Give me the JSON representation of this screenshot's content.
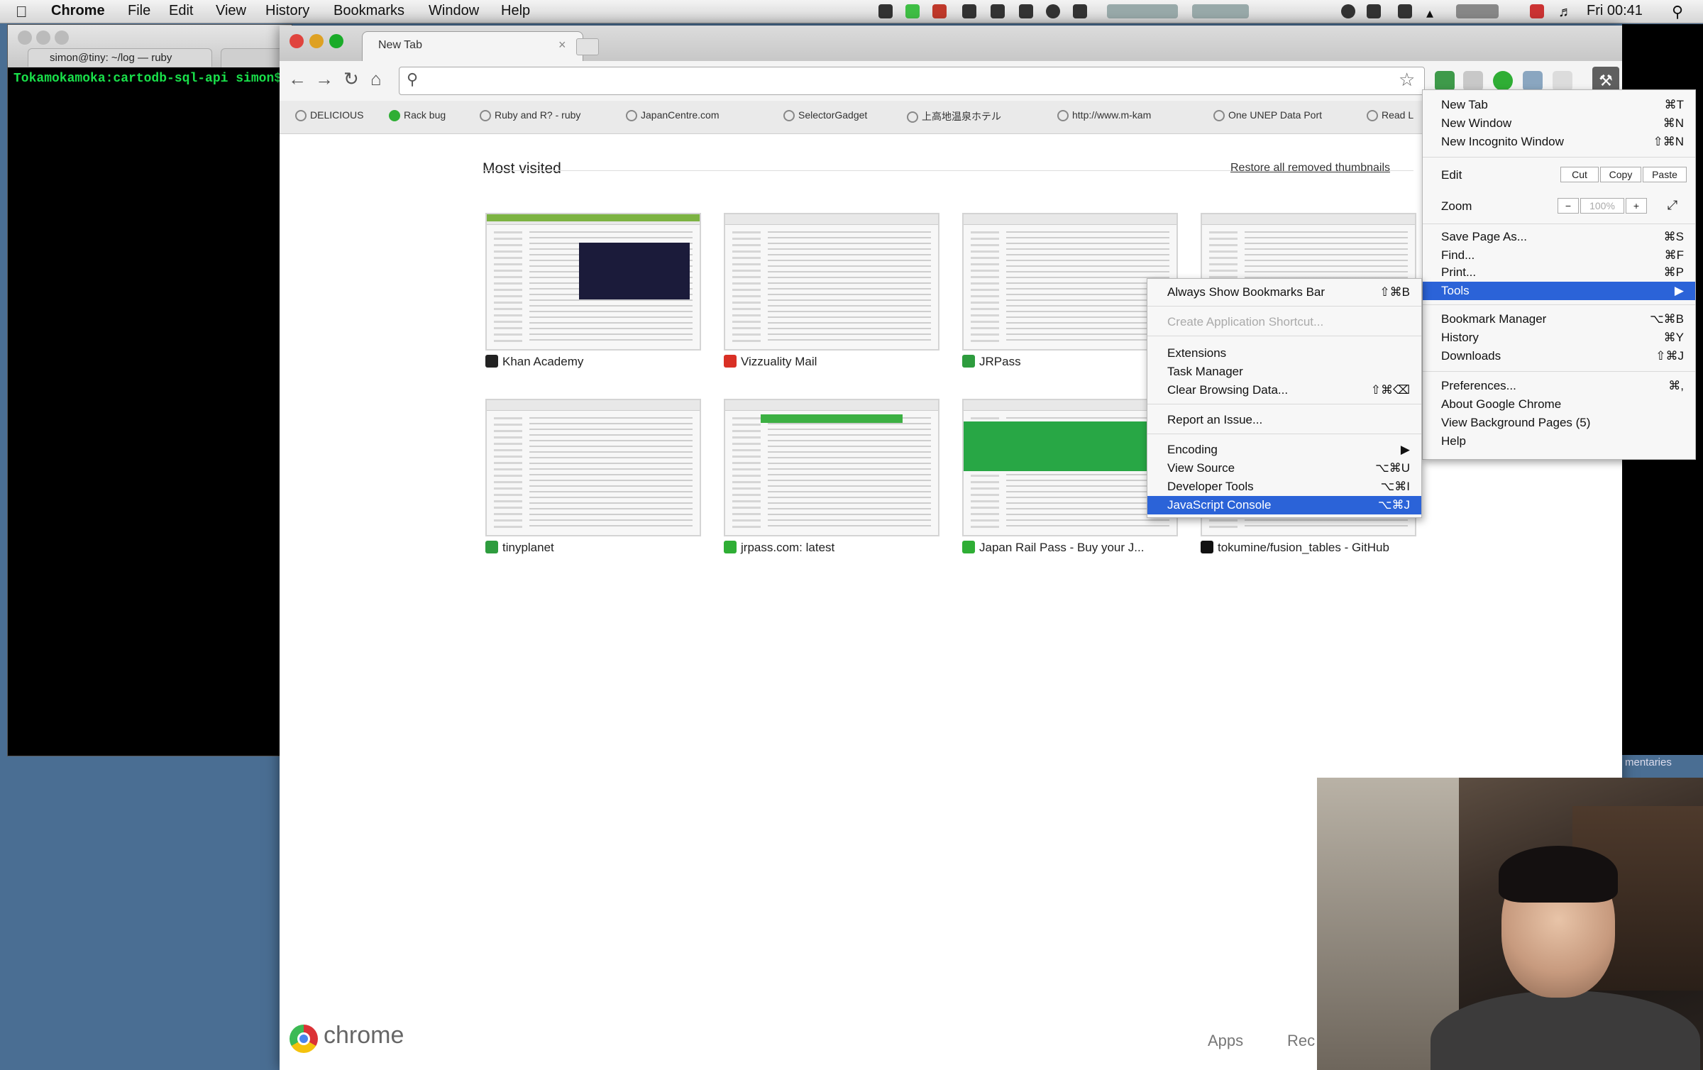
{
  "menubar": {
    "apple": "",
    "app_name": "Chrome",
    "items": [
      "File",
      "Edit",
      "View",
      "History",
      "Bookmarks",
      "Window",
      "Help"
    ],
    "clock": "Fri 00:41"
  },
  "terminal": {
    "tab_label": "simon@tiny: ~/log — ruby",
    "prompt": "Tokamokamoka:cartodb-sql-api simon$"
  },
  "background_label": "mentaries",
  "chrome": {
    "tab_title": "New Tab",
    "tab_close": "×",
    "omnibox_value": "",
    "bookmarks": [
      {
        "label": "DELICIOUS",
        "green": false
      },
      {
        "label": "Rack bug",
        "green": true
      },
      {
        "label": "Ruby and R? - ruby",
        "green": false
      },
      {
        "label": "JapanCentre.com",
        "green": false
      },
      {
        "label": "SelectorGadget",
        "green": false
      },
      {
        "label": "上高地温泉ホテル",
        "green": false
      },
      {
        "label": "http://www.m-kam",
        "green": false
      },
      {
        "label": "One UNEP Data Port",
        "green": false
      },
      {
        "label": "Read L",
        "green": false
      }
    ]
  },
  "newtab": {
    "most_visited_title": "Most visited",
    "restore_link": "Restore all removed thumbnails",
    "thumbs": [
      {
        "label": "Khan Academy",
        "fav_color": "#222222"
      },
      {
        "label": "Vizzuality Mail",
        "fav_color": "#d93025"
      },
      {
        "label": "JRPass",
        "fav_color": "#2e9c3e"
      },
      {
        "label": "",
        "fav_color": "#888888"
      },
      {
        "label": "tinyplanet",
        "fav_color": "#2e9c3e"
      },
      {
        "label": "jrpass.com: latest",
        "fav_color": "#2fae35"
      },
      {
        "label": "Japan Rail Pass - Buy your J...",
        "fav_color": "#2fae35"
      },
      {
        "label": "tokumine/fusion_tables - GitHub",
        "fav_color": "#111111"
      }
    ],
    "chrome_wordmark": "chrome",
    "apps_link": "Apps",
    "rec_link": "Rec"
  },
  "main_menu": {
    "new_tab": {
      "label": "New Tab",
      "shortcut": "⌘T"
    },
    "new_window": {
      "label": "New Window",
      "shortcut": "⌘N"
    },
    "new_incognito": {
      "label": "New Incognito Window",
      "shortcut": "⇧⌘N"
    },
    "edit": {
      "label": "Edit",
      "cut": "Cut",
      "copy": "Copy",
      "paste": "Paste"
    },
    "zoom": {
      "label": "Zoom",
      "minus": "−",
      "value": "100%",
      "plus": "+"
    },
    "save_page": {
      "label": "Save Page As...",
      "shortcut": "⌘S"
    },
    "find": {
      "label": "Find...",
      "shortcut": "⌘F"
    },
    "print": {
      "label": "Print...",
      "shortcut": "⌘P"
    },
    "tools": {
      "label": "Tools",
      "shortcut": "▶"
    },
    "bookmark_manager": {
      "label": "Bookmark Manager",
      "shortcut": "⌥⌘B"
    },
    "history": {
      "label": "History",
      "shortcut": "⌘Y"
    },
    "downloads": {
      "label": "Downloads",
      "shortcut": "⇧⌘J"
    },
    "preferences": {
      "label": "Preferences...",
      "shortcut": "⌘,"
    },
    "about": {
      "label": "About Google Chrome"
    },
    "background_pages": {
      "label": "View Background Pages (5)"
    },
    "help": {
      "label": "Help"
    }
  },
  "tools_menu": {
    "bookmarks_bar": {
      "label": "Always Show Bookmarks Bar",
      "shortcut": "⇧⌘B"
    },
    "create_shortcut": {
      "label": "Create Application Shortcut..."
    },
    "extensions": {
      "label": "Extensions"
    },
    "task_manager": {
      "label": "Task Manager"
    },
    "clear_data": {
      "label": "Clear Browsing Data...",
      "shortcut": "⇧⌘⌫"
    },
    "report_issue": {
      "label": "Report an Issue..."
    },
    "encoding": {
      "label": "Encoding",
      "shortcut": "▶"
    },
    "view_source": {
      "label": "View Source",
      "shortcut": "⌥⌘U"
    },
    "dev_tools": {
      "label": "Developer Tools",
      "shortcut": "⌥⌘I"
    },
    "js_console": {
      "label": "JavaScript Console",
      "shortcut": "⌥⌘J"
    }
  },
  "colors": {
    "menu_highlight": "#2b63d8",
    "terminal_text": "#19e14a",
    "desktop": "#4a6e93"
  }
}
